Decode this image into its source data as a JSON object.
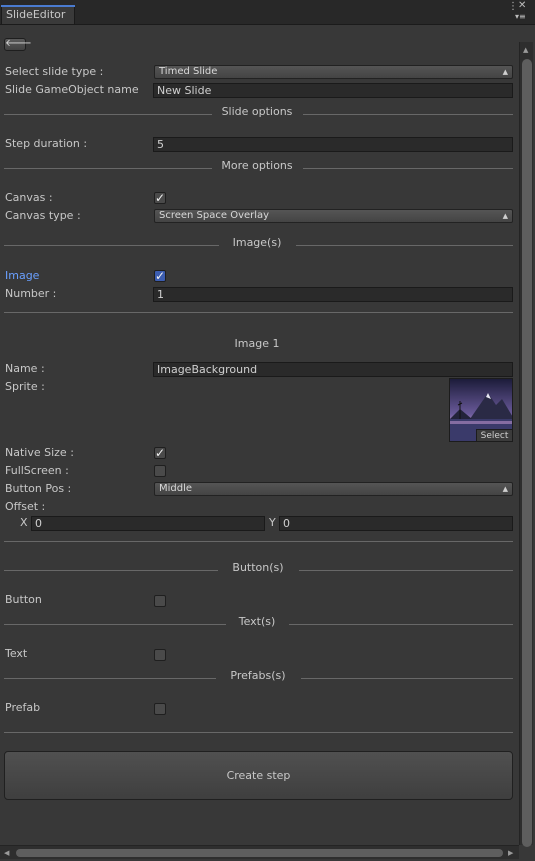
{
  "window": {
    "tab_title": "SlideEditor",
    "icons": [
      "kebab-menu-icon",
      "close-icon",
      "panel-menu-icon"
    ]
  },
  "toolbar": {
    "back_icon": "arrow-left-icon"
  },
  "form": {
    "slide_type_label": "Select slide type :",
    "slide_type_value": "Timed Slide",
    "go_name_label": "Slide GameObject name",
    "go_name_value": "New Slide",
    "slide_options_title": "Slide options",
    "step_duration_label": "Step duration :",
    "step_duration_value": "5",
    "more_options_title": "More options",
    "canvas_label": "Canvas :",
    "canvas_checked": true,
    "canvas_type_label": "Canvas type :",
    "canvas_type_value": "Screen Space Overlay",
    "images_title": "Image(s)",
    "image_label": "Image",
    "image_checked": true,
    "number_label": "Number :",
    "number_value": "1",
    "image1_title": "Image 1",
    "name_label": "Name :",
    "name_value": "ImageBackground",
    "sprite_label": "Sprite :",
    "sprite_select_label": "Select",
    "native_size_label": "Native Size :",
    "native_size_checked": true,
    "fullscreen_label": "FullScreen :",
    "fullscreen_checked": false,
    "button_pos_label": "Button Pos :",
    "button_pos_value": "Middle",
    "offset_label": "Offset :",
    "offset_x_label": "X",
    "offset_x_value": "0",
    "offset_y_label": "Y",
    "offset_y_value": "0",
    "buttons_title": "Button(s)",
    "button_label": "Button",
    "button_checked": false,
    "texts_title": "Text(s)",
    "text_label": "Text",
    "text_checked": false,
    "prefabs_title": "Prefabs(s)",
    "prefab_label": "Prefab",
    "prefab_checked": false
  },
  "actions": {
    "create_step_label": "Create step"
  },
  "colors": {
    "background": "#383838",
    "field": "#2a2a2a",
    "accent_tab": "#4a7bd0",
    "highlight_label": "#6aa0ff",
    "text": "#c8c8c8"
  }
}
